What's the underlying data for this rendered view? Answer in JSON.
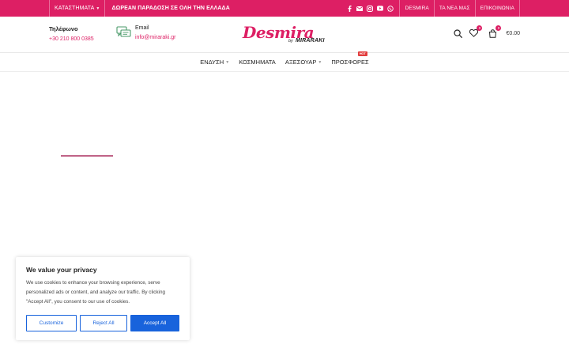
{
  "colors": {
    "brand": "#dd1f64",
    "button_blue": "#1863dc",
    "loader": "#c06387",
    "hot": "#e23d3d"
  },
  "topbar": {
    "stores_label": "ΚΑΤΑΣΤΗΜΑΤΑ",
    "promo_text": "ΔΩΡΕΑΝ ΠΑΡΑΔΟΣΗ ΣΕ ΟΛΗ ΤΗΝ ΕΛΛΑΔΑ",
    "social_icons": [
      "facebook-icon",
      "email-icon",
      "instagram-icon",
      "youtube-icon",
      "whatsapp-icon"
    ],
    "links": [
      "DESMIRA",
      "ΤΑ ΝΕΑ ΜΑΣ",
      "ΕΠΙΚΟΙΝΩΝΙΑ"
    ]
  },
  "header": {
    "phone_title": "Τηλέφωνο",
    "phone_number": "+30 210 800 0385",
    "email_title": "Email",
    "email_address": "info@miraraki.gr",
    "logo_main": "Desmira",
    "logo_by": "by",
    "logo_sub": "MIRARAKI",
    "wishlist_count": "0",
    "cart_count": "0",
    "cart_total": "€0.00"
  },
  "nav": {
    "items": [
      {
        "label": "ΕΝΔΥΣΗ",
        "has_dropdown": true
      },
      {
        "label": "ΚΟΣΜΗΜΑΤΑ",
        "has_dropdown": false
      },
      {
        "label": "ΑΞΕΣΟΥΑΡ",
        "has_dropdown": true
      },
      {
        "label": "ΠΡΟΣΦΟΡΕΣ",
        "has_dropdown": false,
        "badge": "HOT"
      }
    ]
  },
  "cookie": {
    "title": "We value your privacy",
    "text": "We use cookies to enhance your browsing experience, serve personalized ads or content, and analyze our traffic. By clicking \"Accept All\", you consent to our use of cookies.",
    "customize_label": "Customize",
    "reject_label": "Reject All",
    "accept_label": "Accept All"
  }
}
